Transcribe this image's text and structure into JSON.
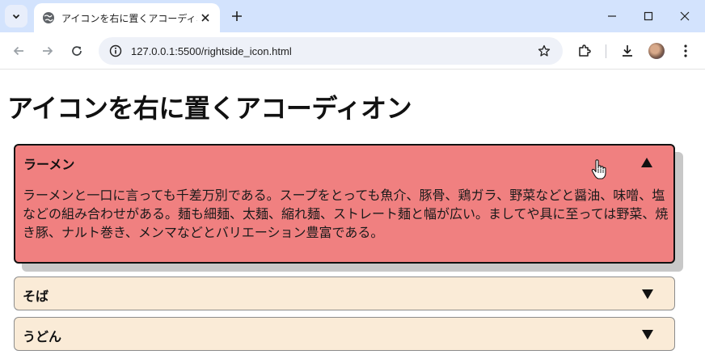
{
  "browser": {
    "tab_title": "アイコンを右に置くアコーディオン",
    "url": "127.0.0.1:5500/rightside_icon.html"
  },
  "page": {
    "heading": "アイコンを右に置くアコーディオン",
    "accordion": [
      {
        "label": "ラーメン",
        "state": "open",
        "icon": "triangle-up-icon",
        "body": "ラーメンと一口に言っても千差万別である。スープをとっても魚介、豚骨、鶏ガラ、野菜などと醤油、味噌、塩などの組み合わせがある。麺も細麺、太麺、縮れ麺、ストレート麺と幅が広い。ましてや具に至っては野菜、焼き豚、ナルト巻き、メンマなどとバリエーション豊富である。"
      },
      {
        "label": "そば",
        "state": "closed",
        "icon": "triangle-down-icon"
      },
      {
        "label": "うどん",
        "state": "closed",
        "icon": "triangle-down-icon"
      }
    ],
    "colors": {
      "open_bg": "#f08080",
      "closed_bg": "#faebd7",
      "tabbar_bg": "#d3e3fd"
    }
  }
}
